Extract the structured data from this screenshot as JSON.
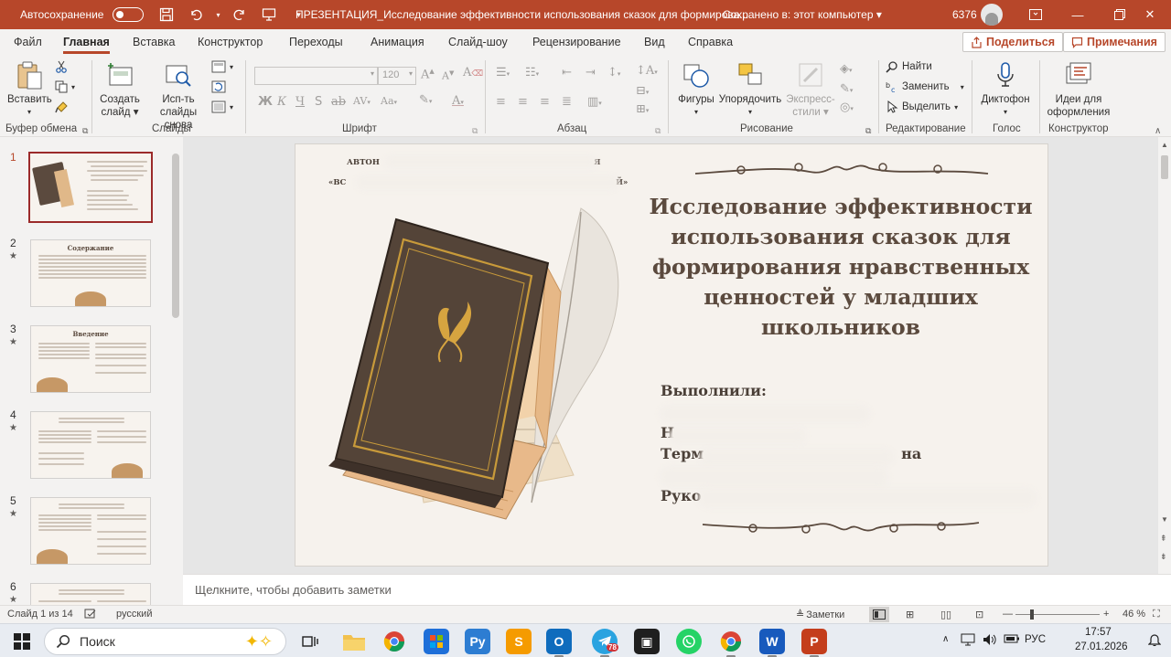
{
  "titlebar": {
    "autosave_label": "Автосохранение",
    "doc_title": "ПРЕЗЕНТАЦИЯ_Исследование эффективности использования сказок для формирова...",
    "saved_status": "Сохранено в: этот компьютер",
    "user_number": "6376"
  },
  "tabs": [
    "Файл",
    "Главная",
    "Вставка",
    "Конструктор",
    "Переходы",
    "Анимация",
    "Слайд-шоу",
    "Рецензирование",
    "Вид",
    "Справка"
  ],
  "share": {
    "label": "Поделиться",
    "comments_label": "Примечания"
  },
  "ribbon": {
    "clipboard": {
      "paste": "Вставить",
      "label": "Буфер обмена"
    },
    "slides": {
      "new_slide_1": "Создать",
      "new_slide_2": "слайд",
      "reuse_1": "Исп-ть",
      "reuse_2": "слайды снова",
      "label": "Слайды"
    },
    "font": {
      "size_value": "120",
      "label": "Шрифт",
      "bold": "Ж",
      "italic": "К",
      "underline": "Ч",
      "strike": "S",
      "abc": "ab"
    },
    "paragraph": {
      "label": "Абзац"
    },
    "drawing": {
      "shapes": "Фигуры",
      "arrange": "Упорядочить",
      "express_1": "Экспресс-",
      "express_2": "стили",
      "label": "Рисование"
    },
    "editing": {
      "find": "Найти",
      "replace": "Заменить",
      "select": "Выделить",
      "label": "Редактирование"
    },
    "voice": {
      "dictate": "Диктофон",
      "label": "Голос"
    },
    "designer": {
      "ideas_1": "Идеи для",
      "ideas_2": "оформления",
      "label": "Конструктор"
    }
  },
  "thumbnails": [
    {
      "number": "1",
      "title": "",
      "selected": true
    },
    {
      "number": "2",
      "title": "Содержание",
      "selected": false
    },
    {
      "number": "3",
      "title": "Введение",
      "selected": false
    },
    {
      "number": "4",
      "title": "",
      "selected": false
    },
    {
      "number": "5",
      "title": "",
      "selected": false
    },
    {
      "number": "6",
      "title": "",
      "selected": false
    }
  ],
  "slide": {
    "org_line_1": "АВТОН",
    "org_line_1_end": "Я",
    "org_line_2": "«ВС",
    "org_line_2_end": "Й»",
    "title": "Исследование эффективности использования сказок для формирования нравственных ценностей у младших школьников",
    "authors_heading": "Выполнили:",
    "author_2_start": "Н",
    "author_3_start": "Терм",
    "author_3_end": "на",
    "supervisor_start": "Руко"
  },
  "notes": {
    "placeholder": "Щелкните, чтобы добавить заметки"
  },
  "status": {
    "slide_counter": "Слайд 1 из 14",
    "language": "русский",
    "notes_button": "Заметки",
    "zoom": "46 %"
  },
  "taskbar": {
    "search": "Поиск",
    "lang": "РУС",
    "time": "17:57",
    "date": "27.01.2026",
    "telegram_badge": "78"
  }
}
